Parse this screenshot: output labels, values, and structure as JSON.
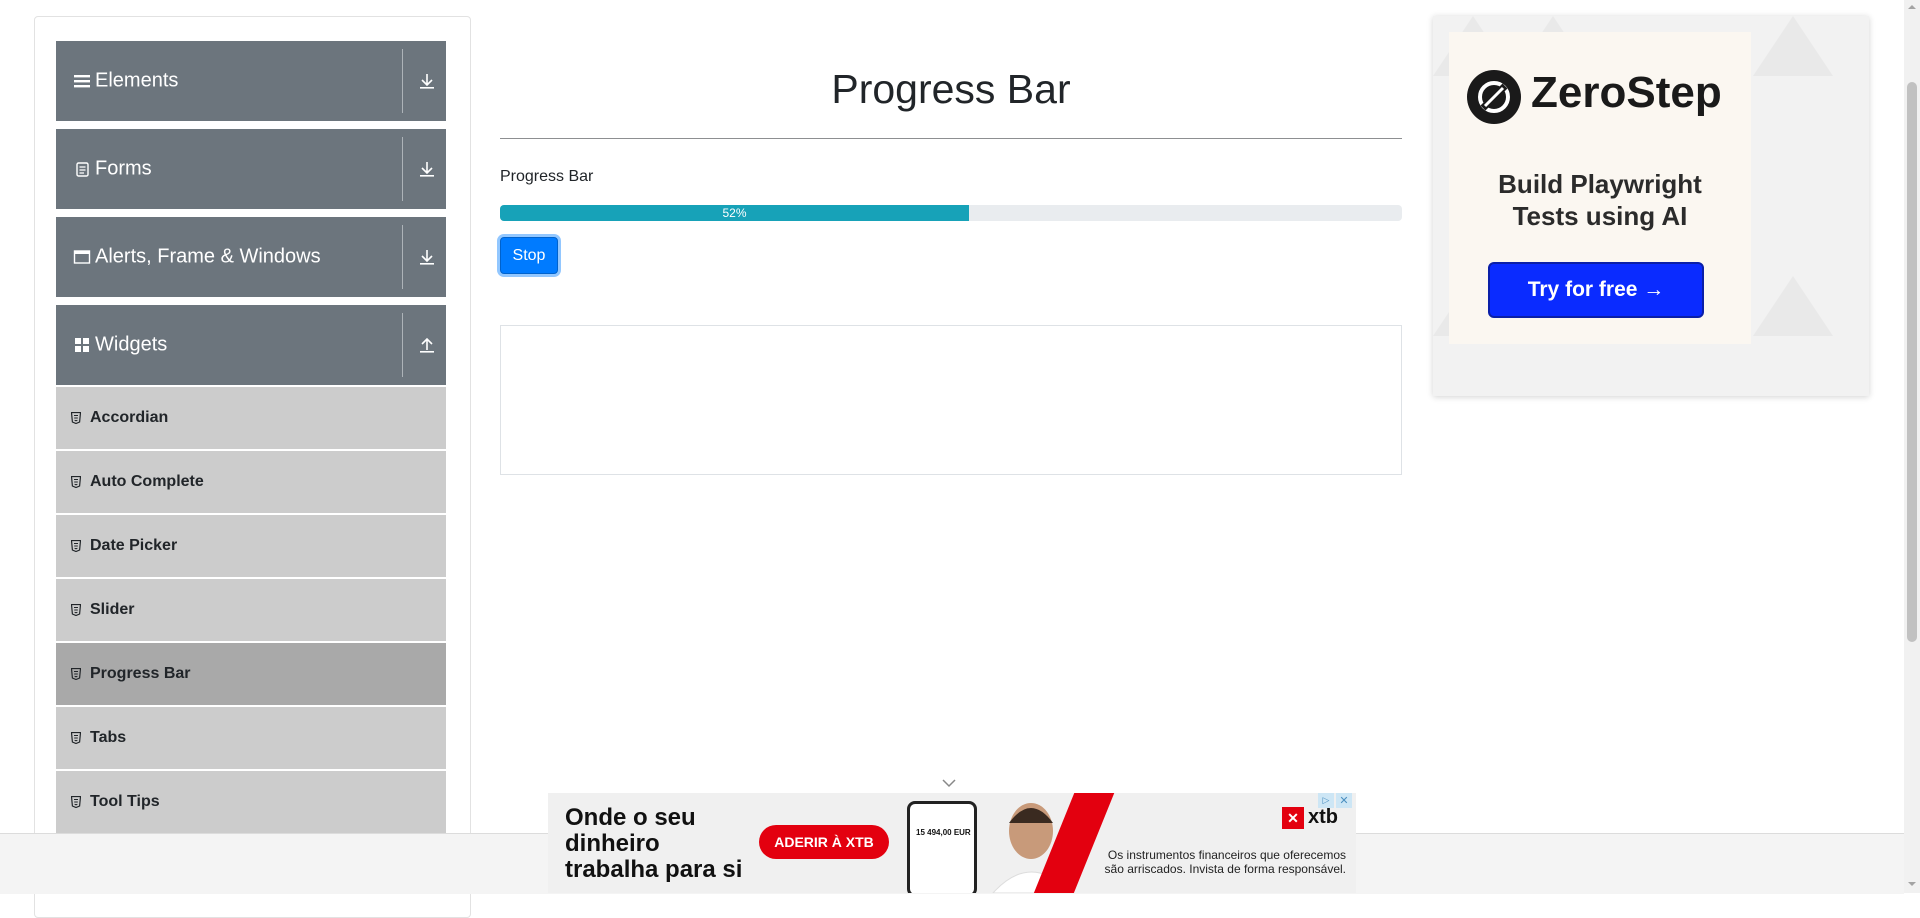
{
  "sidebar": {
    "groups": [
      {
        "title": "Elements",
        "icon": "menu-icon",
        "arrow": "download-arrow-icon"
      },
      {
        "title": "Forms",
        "icon": "document-icon",
        "arrow": "download-arrow-icon"
      },
      {
        "title": "Alerts, Frame & Windows",
        "icon": "window-icon",
        "arrow": "download-arrow-icon"
      },
      {
        "title": "Widgets",
        "icon": "grid-icon",
        "arrow": "upload-arrow-icon"
      }
    ],
    "items": [
      {
        "label": "Accordian"
      },
      {
        "label": "Auto Complete"
      },
      {
        "label": "Date Picker"
      },
      {
        "label": "Slider"
      },
      {
        "label": "Progress Bar",
        "active": true
      },
      {
        "label": "Tabs"
      },
      {
        "label": "Tool Tips"
      }
    ]
  },
  "main": {
    "title": "Progress Bar",
    "progress_label": "Progress Bar",
    "progress": {
      "value": 52,
      "text": "52%"
    },
    "stop_button": "Stop"
  },
  "ad_right": {
    "brand": "ZeroStep",
    "headline": "Build Playwright\nTests using AI",
    "cta": "Try for free →"
  },
  "ad_bottom": {
    "headline": "Onde o seu\ndinheiro\ntrabalha para si",
    "cta": "ADERIR À XTB",
    "phone_value": "15 494,00 EUR",
    "brand": "xtb",
    "disclaimer": "Os instrumentos financeiros que oferecemos\nsão arriscados. Invista de forma responsável.",
    "close_symbol": "✕",
    "adchoices_symbol": "▷"
  },
  "colors": {
    "group_header": "#6c757d",
    "menu_item": "#cccccc",
    "menu_item_active": "#a9a9a9",
    "progress_fill": "#17a2b8",
    "primary_button": "#007bff",
    "ad_cta": "#0a2bff",
    "xtb_red": "#e3000f"
  }
}
